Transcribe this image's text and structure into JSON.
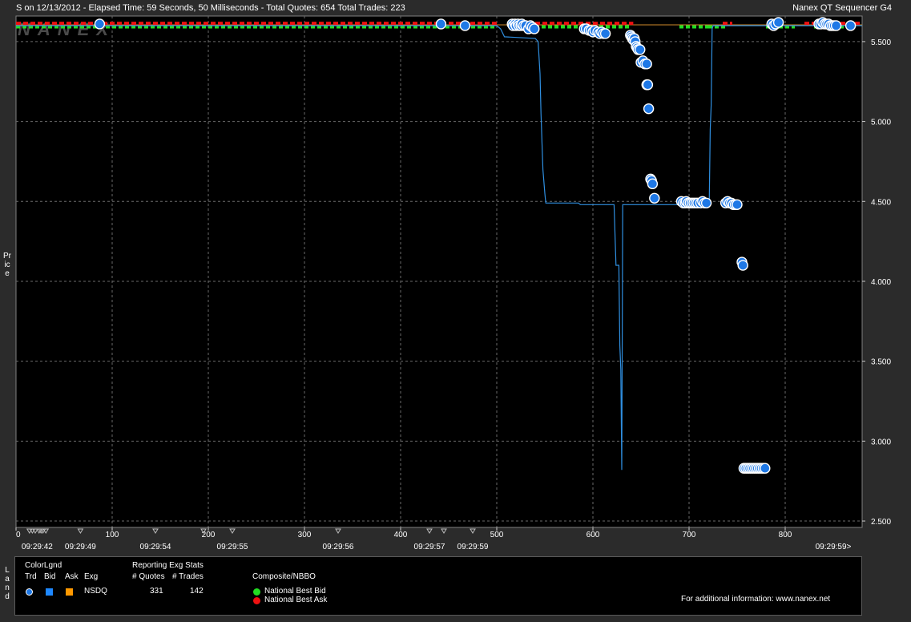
{
  "header": {
    "left_text": "S on 12/13/2012  -  Elapsed Time: 59 Seconds, 50 Milliseconds  -  Total Quotes: 654  Total Trades: 223",
    "right_text": "Nanex QT Sequencer G4"
  },
  "watermark": "NANEX",
  "price_axis_label": "Price",
  "legend_axis_label": "Land",
  "chart_data": {
    "type": "scatter",
    "x_range": [
      0,
      880
    ],
    "y_range": [
      2.46,
      5.66
    ],
    "grid": true,
    "x_ticks": [
      0,
      100,
      200,
      300,
      400,
      500,
      600,
      700,
      800
    ],
    "y_ticks": [
      {
        "value": 2.5,
        "label": "2.500"
      },
      {
        "value": 3.0,
        "label": "3.000"
      },
      {
        "value": 3.5,
        "label": "3.500"
      },
      {
        "value": 4.0,
        "label": "4.000"
      },
      {
        "value": 4.5,
        "label": "4.500"
      },
      {
        "value": 5.0,
        "label": "5.000"
      },
      {
        "value": 5.5,
        "label": "5.500"
      }
    ],
    "time_labels": [
      {
        "x": 22,
        "label": "09:29:42"
      },
      {
        "x": 67,
        "label": "09:29:49"
      },
      {
        "x": 145,
        "label": "09:29:54"
      },
      {
        "x": 225,
        "label": "09:29:55"
      },
      {
        "x": 335,
        "label": "09:29:56"
      },
      {
        "x": 430,
        "label": "09:29:57"
      },
      {
        "x": 475,
        "label": "09:29:59"
      },
      {
        "x": 850,
        "label": "09:29:59>"
      }
    ],
    "time_markers": [
      14,
      17,
      20,
      24,
      26,
      28,
      31,
      67,
      145,
      195,
      225,
      335,
      430,
      445,
      475
    ],
    "nbbo_bid_segments": [
      [
        0,
        500
      ],
      [
        520,
        640
      ],
      [
        690,
        720
      ],
      [
        720,
        740
      ],
      [
        780,
        810
      ],
      [
        830,
        870
      ]
    ],
    "nbbo_ask_segments": [
      [
        0,
        500
      ],
      [
        525,
        642
      ],
      [
        735,
        745
      ],
      [
        820,
        880
      ]
    ],
    "bid_line": [
      [
        0,
        5.6
      ],
      [
        500,
        5.6
      ],
      [
        504,
        5.58
      ],
      [
        508,
        5.53
      ],
      [
        540,
        5.52
      ],
      [
        543,
        5.5
      ],
      [
        545,
        5.3
      ],
      [
        546,
        5.05
      ],
      [
        548,
        4.7
      ],
      [
        550,
        4.55
      ],
      [
        551,
        4.49
      ],
      [
        585,
        4.49
      ],
      [
        587,
        4.48
      ],
      [
        622,
        4.48
      ],
      [
        624,
        4.1
      ],
      [
        627,
        4.1
      ],
      [
        628,
        3.6
      ],
      [
        629,
        3.45
      ],
      [
        630,
        2.82
      ],
      [
        631,
        4.48
      ],
      [
        720,
        4.48
      ],
      [
        721,
        4.49
      ],
      [
        722,
        4.95
      ],
      [
        723,
        5.1
      ],
      [
        724,
        5.58
      ],
      [
        725,
        5.6
      ],
      [
        880,
        5.6
      ]
    ],
    "trades": [
      [
        87,
        5.61
      ],
      [
        442,
        5.61
      ],
      [
        467,
        5.6
      ],
      [
        516,
        5.61
      ],
      [
        517,
        5.6
      ],
      [
        519,
        5.61
      ],
      [
        520,
        5.6
      ],
      [
        522,
        5.61
      ],
      [
        523,
        5.6
      ],
      [
        525,
        5.6
      ],
      [
        526,
        5.61
      ],
      [
        528,
        5.6
      ],
      [
        530,
        5.6
      ],
      [
        533,
        5.58
      ],
      [
        535,
        5.6
      ],
      [
        537,
        5.59
      ],
      [
        539,
        5.58
      ],
      [
        591,
        5.58
      ],
      [
        593,
        5.58
      ],
      [
        596,
        5.57
      ],
      [
        598,
        5.57
      ],
      [
        600,
        5.56
      ],
      [
        602,
        5.57
      ],
      [
        605,
        5.56
      ],
      [
        607,
        5.55
      ],
      [
        609,
        5.56
      ],
      [
        611,
        5.55
      ],
      [
        613,
        5.55
      ],
      [
        639,
        5.54
      ],
      [
        640,
        5.53
      ],
      [
        641,
        5.52
      ],
      [
        642,
        5.51
      ],
      [
        643,
        5.52
      ],
      [
        644,
        5.5
      ],
      [
        645,
        5.47
      ],
      [
        646,
        5.46
      ],
      [
        647,
        5.45
      ],
      [
        649,
        5.45
      ],
      [
        650,
        5.37
      ],
      [
        652,
        5.38
      ],
      [
        654,
        5.36
      ],
      [
        656,
        5.36
      ],
      [
        656,
        5.23
      ],
      [
        657,
        5.23
      ],
      [
        658,
        5.08
      ],
      [
        660,
        4.64
      ],
      [
        661,
        4.63
      ],
      [
        662,
        4.61
      ],
      [
        664,
        4.52
      ],
      [
        692,
        4.5
      ],
      [
        694,
        4.49
      ],
      [
        696,
        4.49
      ],
      [
        697,
        4.5
      ],
      [
        699,
        4.49
      ],
      [
        701,
        4.49
      ],
      [
        703,
        4.49
      ],
      [
        705,
        4.49
      ],
      [
        707,
        4.49
      ],
      [
        709,
        4.49
      ],
      [
        712,
        4.49
      ],
      [
        714,
        4.5
      ],
      [
        716,
        4.49
      ],
      [
        718,
        4.49
      ],
      [
        738,
        4.49
      ],
      [
        740,
        4.5
      ],
      [
        742,
        4.49
      ],
      [
        744,
        4.49
      ],
      [
        746,
        4.48
      ],
      [
        748,
        4.48
      ],
      [
        750,
        4.48
      ],
      [
        755,
        4.12
      ],
      [
        756,
        4.1
      ],
      [
        757,
        2.83
      ],
      [
        759,
        2.83
      ],
      [
        761,
        2.83
      ],
      [
        763,
        2.83
      ],
      [
        765,
        2.83
      ],
      [
        767,
        2.83
      ],
      [
        769,
        2.83
      ],
      [
        771,
        2.83
      ],
      [
        773,
        2.83
      ],
      [
        775,
        2.83
      ],
      [
        777,
        2.83
      ],
      [
        779,
        2.83
      ],
      [
        786,
        5.61
      ],
      [
        788,
        5.6
      ],
      [
        790,
        5.61
      ],
      [
        793,
        5.62
      ],
      [
        835,
        5.61
      ],
      [
        837,
        5.61
      ],
      [
        839,
        5.62
      ],
      [
        841,
        5.61
      ],
      [
        843,
        5.61
      ],
      [
        845,
        5.61
      ],
      [
        847,
        5.6
      ],
      [
        849,
        5.6
      ],
      [
        851,
        5.6
      ],
      [
        853,
        5.6
      ],
      [
        868,
        5.6
      ]
    ],
    "colors": {
      "trade_fill": "#1e78e6",
      "trade_stroke": "#ffffff",
      "bid_line": "#2f8fe0",
      "nbbo_bid": "#22dd22",
      "nbbo_ask": "#ee1111",
      "grid": "#6a6a6a",
      "plot_bg": "#000000",
      "frame_bg": "#2b2b2b"
    }
  },
  "legend": {
    "title": "ColorLgnd",
    "col_trd": "Trd",
    "col_bid": "Bid",
    "col_ask": "Ask",
    "col_exg": "Exg",
    "exchange": "NSDQ",
    "stats_title": "Reporting Exg Stats",
    "col_quotes": "# Quotes",
    "col_trades": "# Trades",
    "quotes_value": "331",
    "trades_value": "142",
    "composite_title": "Composite/NBBO",
    "nbbo_bid_label": "National Best Bid",
    "nbbo_ask_label": "National Best Ask",
    "info_text": "For additional information: www.nanex.net",
    "colors": {
      "bid_square": "#1e88ff",
      "ask_square": "#ff9900",
      "trd_dot": "#1e78e6"
    }
  }
}
